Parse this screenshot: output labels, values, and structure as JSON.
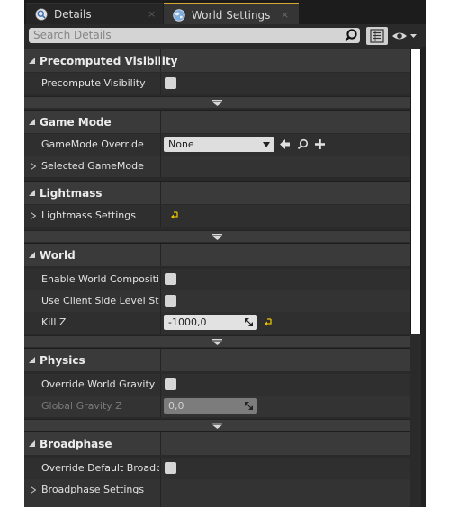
{
  "tabs": [
    {
      "label": "Details",
      "icon": "details-magnifier-icon",
      "close": "×",
      "active": false
    },
    {
      "label": "World Settings",
      "icon": "world-globe-icon",
      "close": "×",
      "active": true
    }
  ],
  "search": {
    "placeholder": "Search Details"
  },
  "colors": {
    "accent_tab": "#d8a930",
    "reset_arrow": "#e8c000",
    "panel_bg": "#2a2a2a",
    "category_bg": "#3a3a3a"
  },
  "sections": {
    "precomputed_visibility": {
      "title": "Precomputed Visibility",
      "precompute_visibility": {
        "label": "Precompute Visibility",
        "checked": false
      }
    },
    "game_mode": {
      "title": "Game Mode",
      "gamemode_override": {
        "label": "GameMode Override",
        "value": "None"
      },
      "selected_gamemode": {
        "label": "Selected GameMode"
      }
    },
    "lightmass": {
      "title": "Lightmass",
      "lightmass_settings": {
        "label": "Lightmass Settings"
      }
    },
    "world": {
      "title": "World",
      "enable_world_composition": {
        "label": "Enable World Composition",
        "checked": false
      },
      "use_client_side_level_streaming": {
        "label": "Use Client Side Level Strea",
        "checked": false
      },
      "kill_z": {
        "label": "Kill Z",
        "value": "-1000,0"
      }
    },
    "physics": {
      "title": "Physics",
      "override_world_gravity": {
        "label": "Override World Gravity",
        "checked": false
      },
      "global_gravity_z": {
        "label": "Global Gravity Z",
        "value": "0,0",
        "enabled": false
      }
    },
    "broadphase": {
      "title": "Broadphase",
      "override_default_broadphase": {
        "label": "Override Default Broadpha",
        "checked": false
      },
      "broadphase_settings": {
        "label": "Broadphase Settings"
      }
    }
  }
}
